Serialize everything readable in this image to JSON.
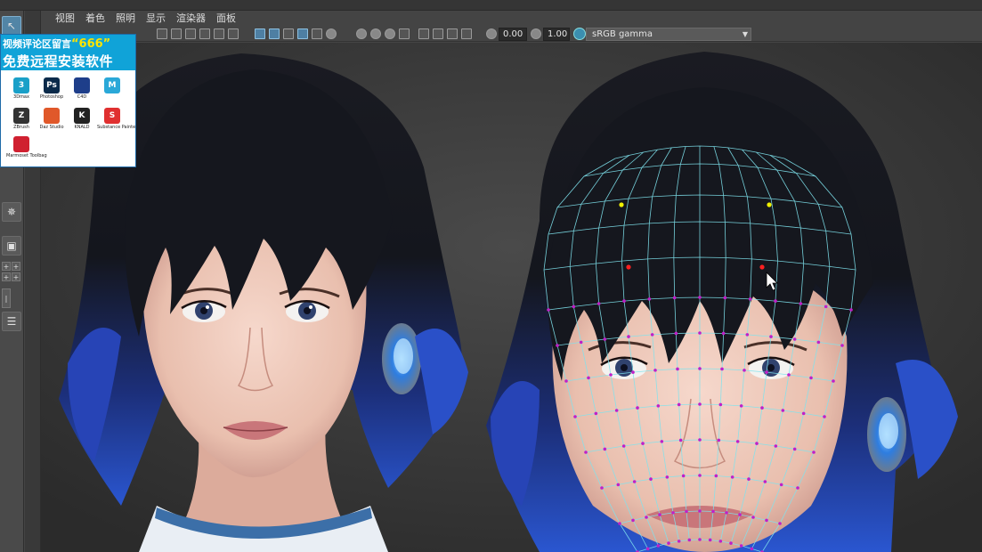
{
  "menubar": {
    "items": [
      "视图",
      "着色",
      "照明",
      "显示",
      "渲染器",
      "面板"
    ]
  },
  "viewport_toolbar": {
    "field_one": "0.00",
    "field_two": "1.00",
    "color_space": "sRGB gamma"
  },
  "promo": {
    "line1_prefix": "视频评论区留言",
    "line1_number": "“666”",
    "line2": "免费远程安装软件",
    "software": [
      {
        "label": "3Dmax",
        "icon_text": "3",
        "color": "#1aa0c8"
      },
      {
        "label": "Photoshop",
        "icon_text": "Ps",
        "color": "#0a2a4a"
      },
      {
        "label": "C4D",
        "icon_text": "",
        "color": "#1e3e8a"
      },
      {
        "label": "",
        "icon_text": "M",
        "color": "#2aa8d8"
      },
      {
        "label": "ZBrush",
        "icon_text": "Z",
        "color": "#333333"
      },
      {
        "label": "Daz Studio",
        "icon_text": "",
        "color": "#e0582a"
      },
      {
        "label": "KNALD",
        "icon_text": "K",
        "color": "#222222"
      },
      {
        "label": "Substance Painter",
        "icon_text": "S",
        "color": "#e03030"
      },
      {
        "label": "Marmoset Toolbag",
        "icon_text": "",
        "color": "#d02030"
      }
    ]
  },
  "icons": {
    "cursor_tool": "select-arrow-icon",
    "color_space_badge": "color-management-icon"
  },
  "colors": {
    "viewport_bg": "#3a3a3a",
    "active_blue": "#5285a6",
    "wire_cyan": "#7fe3ee",
    "vertex_magenta": "#c020c8",
    "hair_blue": "#2a54c8"
  }
}
